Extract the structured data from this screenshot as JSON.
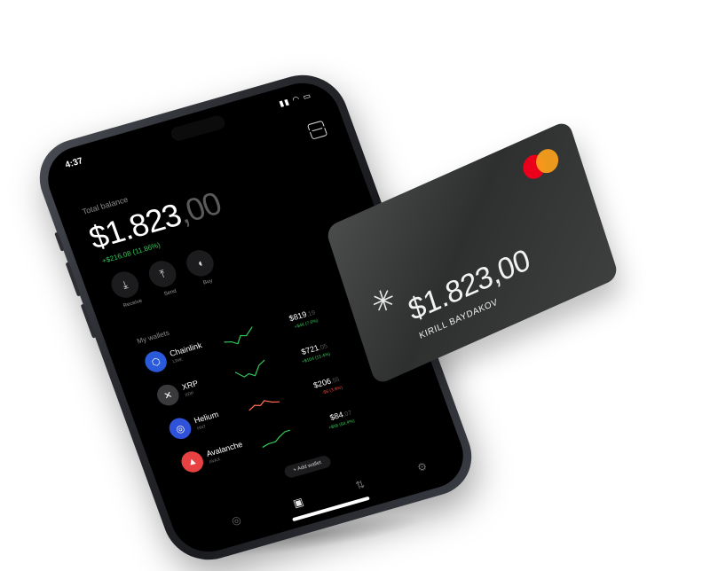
{
  "status_bar": {
    "time": "4:37",
    "icons": "▮▮ ◠ ▭"
  },
  "header": {
    "total_label": "Total balance",
    "balance_int": "$1.823",
    "balance_dec": ",00",
    "change": "+$216.08 (11.86%)"
  },
  "actions": [
    {
      "label": "Receive",
      "icon": "download-icon"
    },
    {
      "label": "Send",
      "icon": "upload-icon"
    },
    {
      "label": "Buy",
      "icon": "bag-icon"
    }
  ],
  "wallets_title": "My wallets",
  "wallets": [
    {
      "name": "Chainlink",
      "ticker": "LINK",
      "price": "$819",
      "cents": ",19",
      "delta": "+$44 (7.6%)",
      "trend": "up",
      "color": "#2a5ada",
      "glyph": "⬡"
    },
    {
      "name": "XRP",
      "ticker": "XRP",
      "price": "$721",
      "cents": ",05",
      "delta": "+$104 (15.4%)",
      "trend": "up",
      "color": "#3a3a3c",
      "glyph": "✕"
    },
    {
      "name": "Helium",
      "ticker": "HNT",
      "price": "$206",
      "cents": ",55",
      "delta": "-$6 (3.8%)",
      "trend": "down",
      "color": "#2f52d8",
      "glyph": "◎"
    },
    {
      "name": "Avalanche",
      "ticker": "AVAX",
      "price": "$84",
      "cents": ",07",
      "delta": "+$56 (64.4%)",
      "trend": "up",
      "color": "#e84142",
      "glyph": "▲"
    }
  ],
  "add_wallet": "+ Add wallet",
  "tabbar": [
    {
      "icon": "coin-icon",
      "glyph": "◎"
    },
    {
      "icon": "wallet-icon",
      "glyph": "▣"
    },
    {
      "icon": "swap-icon",
      "glyph": "⇅"
    },
    {
      "icon": "gear-icon",
      "glyph": "⚙"
    }
  ],
  "card": {
    "amount": "$1.823,00",
    "holder": "KIRILL BAYDAKOV",
    "star": "✳"
  },
  "colors": {
    "accent_green": "#34c759",
    "accent_red": "#ff453a",
    "card_bg": "#3a3d3c"
  }
}
